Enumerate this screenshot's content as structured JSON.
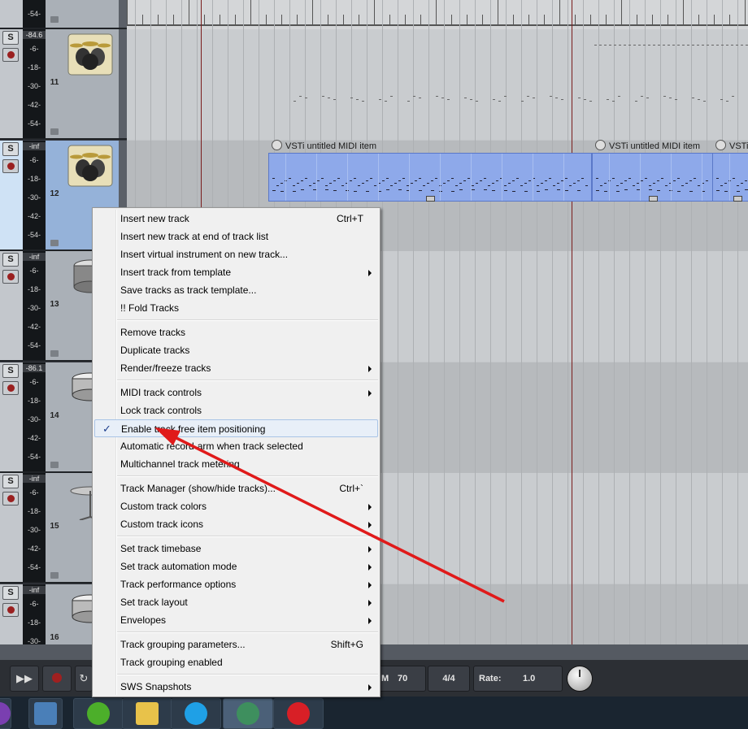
{
  "tracks": [
    {
      "number": "11",
      "peak": "-84.6",
      "scale": [
        "-6-",
        "-18-",
        "-30-",
        "-42-",
        "-54-"
      ],
      "solo_label": "S",
      "icon": "drum-kit-icon",
      "selected": false
    },
    {
      "number": "12",
      "peak": "-inf",
      "scale": [
        "-6-",
        "-18-",
        "-30-",
        "-42-",
        "-54-"
      ],
      "solo_label": "S",
      "icon": "drum-kit-icon",
      "selected": true
    },
    {
      "number": "13",
      "peak": "-inf",
      "scale": [
        "-6-",
        "-18-",
        "-30-",
        "-42-",
        "-54-"
      ],
      "solo_label": "S",
      "icon": "tom-drum-icon",
      "selected": false
    },
    {
      "number": "14",
      "peak": "-86.1",
      "scale": [
        "-6-",
        "-18-",
        "-30-",
        "-42-",
        "-54-"
      ],
      "solo_label": "S",
      "icon": "snare-drum-icon",
      "selected": false
    },
    {
      "number": "15",
      "peak": "-inf",
      "scale": [
        "-6-",
        "-18-",
        "-30-",
        "-42-",
        "-54-"
      ],
      "solo_label": "S",
      "icon": "cymbal-icon",
      "selected": false
    },
    {
      "number": "16",
      "peak": "-inf",
      "scale": [
        "-6-",
        "-18-",
        "-30-"
      ],
      "solo_label": "S",
      "icon": "snare-drum-icon",
      "selected": false
    }
  ],
  "top_partial_label": "-54-",
  "midi_items": [
    {
      "label": "VSTi untitled MIDI item"
    },
    {
      "label": "VSTi untitled MIDI item"
    },
    {
      "label": "VSTi"
    }
  ],
  "transport": {
    "bpm_prefix": "M",
    "bpm": "70",
    "time_signature": "4/4",
    "rate_label": "Rate:",
    "rate_value": "1.0"
  },
  "context_menu": {
    "groups": [
      [
        {
          "label": "Insert new track",
          "shortcut": "Ctrl+T",
          "submenu": false
        },
        {
          "label": "Insert new track at end of track list",
          "shortcut": "",
          "submenu": false
        },
        {
          "label": "Insert virtual instrument on new track...",
          "shortcut": "",
          "submenu": false
        },
        {
          "label": "Insert track from template",
          "shortcut": "",
          "submenu": true
        },
        {
          "label": "Save tracks as track template...",
          "shortcut": "",
          "submenu": false
        },
        {
          "label": "!! Fold Tracks",
          "shortcut": "",
          "submenu": false
        }
      ],
      [
        {
          "label": "Remove tracks",
          "shortcut": "",
          "submenu": false
        },
        {
          "label": "Duplicate tracks",
          "shortcut": "",
          "submenu": false
        },
        {
          "label": "Render/freeze tracks",
          "shortcut": "",
          "submenu": true
        }
      ],
      [
        {
          "label": "MIDI track controls",
          "shortcut": "",
          "submenu": true
        },
        {
          "label": "Lock track controls",
          "shortcut": "",
          "submenu": false
        },
        {
          "label": "Enable track free item positioning",
          "shortcut": "",
          "submenu": false,
          "checked": true,
          "highlighted": true
        },
        {
          "label": "Automatic record-arm when track selected",
          "shortcut": "",
          "submenu": false
        },
        {
          "label": "Multichannel track metering",
          "shortcut": "",
          "submenu": false
        }
      ],
      [
        {
          "label": "Track Manager (show/hide tracks)...",
          "shortcut": "Ctrl+`",
          "submenu": false
        },
        {
          "label": "Custom track colors",
          "shortcut": "",
          "submenu": true
        },
        {
          "label": "Custom track icons",
          "shortcut": "",
          "submenu": true
        }
      ],
      [
        {
          "label": "Set track timebase",
          "shortcut": "",
          "submenu": true
        },
        {
          "label": "Set track automation mode",
          "shortcut": "",
          "submenu": true
        },
        {
          "label": "Track performance options",
          "shortcut": "",
          "submenu": true
        },
        {
          "label": "Set track layout",
          "shortcut": "",
          "submenu": true
        },
        {
          "label": "Envelopes",
          "shortcut": "",
          "submenu": true
        }
      ],
      [
        {
          "label": "Track grouping parameters...",
          "shortcut": "Shift+G",
          "submenu": false
        },
        {
          "label": "Track grouping enabled",
          "shortcut": "",
          "submenu": false
        }
      ],
      [
        {
          "label": "SWS Snapshots",
          "shortcut": "",
          "submenu": true
        }
      ]
    ],
    "check_glyph": "✓"
  },
  "taskbar": [
    {
      "icon": "app-icon-purple",
      "color": "#7a3fb0"
    },
    {
      "icon": "calculator-icon",
      "color": "#4a7fb8"
    },
    {
      "icon": "utorrent-icon",
      "color": "#4caf2a"
    },
    {
      "icon": "file-explorer-icon",
      "color": "#e8c24a"
    },
    {
      "icon": "skype-icon",
      "color": "#1fa0e6"
    },
    {
      "icon": "reaper-icon",
      "color": "#3e8f5e"
    },
    {
      "icon": "opera-icon",
      "color": "#d81f26"
    }
  ],
  "annotation_arrow_color": "#e01a1a"
}
